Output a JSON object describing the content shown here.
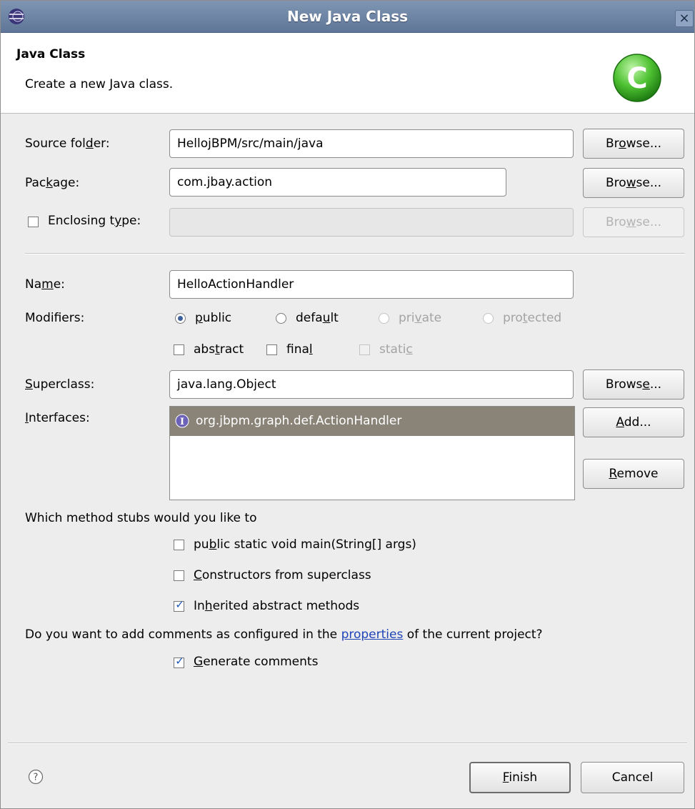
{
  "window": {
    "title": "New Java Class",
    "close_label": "×"
  },
  "header": {
    "title": "Java Class",
    "description": "Create a new Java class."
  },
  "source_folder": {
    "label": "Source folder:",
    "value": "HellojBPM/src/main/java",
    "browse_label": "Browse..."
  },
  "package": {
    "label": "Package:",
    "value": "com.jbay.action",
    "browse_label": "Browse..."
  },
  "enclosing_type": {
    "label": "Enclosing type:",
    "checked": false,
    "value": "",
    "browse_label": "Browse..."
  },
  "name": {
    "label": "Name:",
    "value": "HelloActionHandler"
  },
  "modifiers": {
    "label": "Modifiers:",
    "access": [
      {
        "label": "public",
        "selected": true,
        "enabled": true
      },
      {
        "label": "default",
        "selected": false,
        "enabled": true
      },
      {
        "label": "private",
        "selected": false,
        "enabled": false
      },
      {
        "label": "protected",
        "selected": false,
        "enabled": false
      }
    ],
    "flags": [
      {
        "label": "abstract",
        "checked": false,
        "enabled": true
      },
      {
        "label": "final",
        "checked": false,
        "enabled": true
      },
      {
        "label": "static",
        "checked": false,
        "enabled": false
      }
    ]
  },
  "superclass": {
    "label": "Superclass:",
    "value": "java.lang.Object",
    "browse_label": "Browse..."
  },
  "interfaces": {
    "label": "Interfaces:",
    "items": [
      "org.jbpm.graph.def.ActionHandler"
    ],
    "add_label": "Add...",
    "remove_label": "Remove"
  },
  "stubs": {
    "question": "Which method stubs would you like to",
    "options": [
      {
        "label": "public static void main(String[] args)",
        "checked": false
      },
      {
        "label": "Constructors from superclass",
        "checked": false
      },
      {
        "label": "Inherited abstract methods",
        "checked": true
      }
    ]
  },
  "comments": {
    "question_prefix": "Do you want to add comments as configured in the",
    "link": "properties",
    "question_suffix": "of the current project?",
    "option_label": "Generate comments",
    "checked": true
  },
  "footer": {
    "finish_label": "Finish",
    "cancel_label": "Cancel"
  },
  "icons": {
    "title": "eclipse-icon",
    "header": "class-c-icon",
    "interface": "interface-i-icon",
    "help": "help-question-icon"
  },
  "colors": {
    "titlebar": "#6d84a8",
    "selection": "#8a8478",
    "header_icon": "#3fae2a",
    "link": "#1f44b8"
  }
}
